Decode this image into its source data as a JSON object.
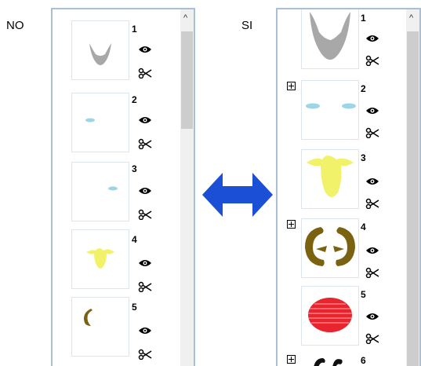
{
  "labels": {
    "left": "NO",
    "right": "SI"
  },
  "left_panel": {
    "items": [
      {
        "number": "1"
      },
      {
        "number": "2"
      },
      {
        "number": "3"
      },
      {
        "number": "4"
      },
      {
        "number": "5"
      }
    ]
  },
  "right_panel": {
    "items": [
      {
        "number": "1"
      },
      {
        "number": "2"
      },
      {
        "number": "3"
      },
      {
        "number": "4"
      },
      {
        "number": "5"
      },
      {
        "number": "6"
      }
    ]
  },
  "colors": {
    "arrow": "#1a4fd6",
    "panel_border": "#a9bfd6",
    "shape_gray": "#a8a8a8",
    "shape_blue": "#9dd5e8",
    "shape_yellow": "#f2f26a",
    "shape_olive": "#7a6210",
    "shape_red": "#e8242e"
  },
  "icons": [
    "eye-icon",
    "scissors-icon",
    "expand-icon",
    "scroll-up-arrow-icon"
  ]
}
